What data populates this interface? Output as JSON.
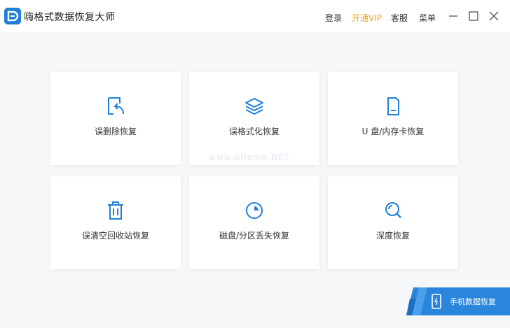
{
  "app": {
    "title": "嗨格式数据恢复大师",
    "accent_color": "#1d7fd8"
  },
  "header": {
    "login_label": "登录",
    "vip_label": "开通VIP",
    "service_label": "客服",
    "menu_label": "菜单"
  },
  "cards": [
    {
      "label": "误删除恢复",
      "icon": "file-restore-icon"
    },
    {
      "label": "误格式化恢复",
      "icon": "layers-icon"
    },
    {
      "label": "U 盘/内存卡恢复",
      "icon": "sd-card-icon"
    },
    {
      "label": "误清空回收站恢复",
      "icon": "trash-icon"
    },
    {
      "label": "磁盘/分区丢失恢复",
      "icon": "pie-chart-icon"
    },
    {
      "label": "深度恢复",
      "icon": "magnifier-icon"
    }
  ],
  "watermark": "www.pHome.NET",
  "mobile": {
    "label": "手机数据恢复",
    "icon": "phone-icon"
  }
}
